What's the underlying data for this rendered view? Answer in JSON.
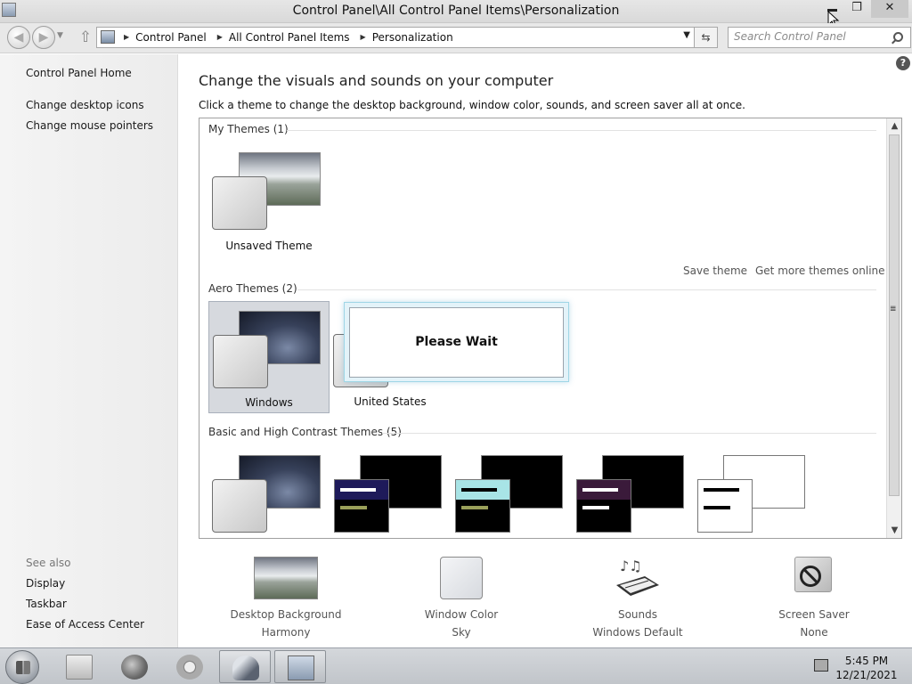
{
  "window": {
    "title": "Control Panel\\All Control Panel Items\\Personalization",
    "close_label": "✕",
    "max_label": "❐"
  },
  "nav": {
    "breadcrumbs": [
      "Control Panel",
      "All Control Panel Items",
      "Personalization"
    ],
    "search_placeholder": "Search Control Panel"
  },
  "left_pane": {
    "home": "Control Panel Home",
    "links": [
      "Change desktop icons",
      "Change mouse pointers"
    ],
    "see_also_label": "See also",
    "see_also": [
      "Display",
      "Taskbar",
      "Ease of Access Center"
    ]
  },
  "content": {
    "title": "Change the visuals and sounds on your computer",
    "subtitle": "Click a theme to change the desktop background, window color, sounds, and screen saver all at once.",
    "help_label": "?",
    "groups": {
      "my_themes": "My Themes (1)",
      "aero_themes": "Aero Themes (2)",
      "basic_themes": "Basic and High Contrast Themes (5)"
    },
    "themes": {
      "unsaved": "Unsaved Theme",
      "windows": "Windows",
      "united_states": "United States"
    },
    "links": {
      "save_theme": "Save theme",
      "get_more": "Get more themes online"
    },
    "selected_theme": "Windows"
  },
  "dialog": {
    "message": "Please Wait"
  },
  "bottom": [
    {
      "label": "Desktop Background",
      "value": "Harmony"
    },
    {
      "label": "Window Color",
      "value": "Sky"
    },
    {
      "label": "Sounds",
      "value": "Windows Default"
    },
    {
      "label": "Screen Saver",
      "value": "None"
    }
  ],
  "taskbar": {
    "time": "5:45 PM",
    "date": "12/21/2021"
  },
  "colors": {
    "selection": "#d6d9de",
    "dialog_border": "#9fd6e6",
    "window_color_sky": "#dfe3e8"
  }
}
